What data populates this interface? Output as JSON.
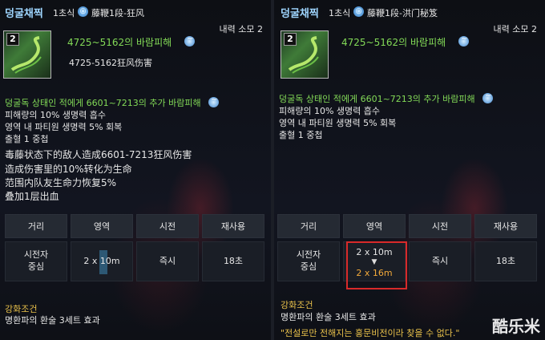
{
  "left": {
    "skill_name": "덩굴채찍",
    "level": "1초식",
    "subtitle_zh": "藤鞭1段-狂风",
    "cost": "내력 소모 2",
    "icon_num": "2",
    "damage": "4725~5162의 바람피해",
    "damage_zh": "4725-5162狂风伤害",
    "extra_damage": "덩굴독 상태인 적에게 6601~7213의 추가 바람피해",
    "lines_ko": [
      "피해량의 10% 생명력 흡수",
      "영역 내 파티원 생명력 5% 회복",
      "출혈 1 중첩"
    ],
    "lines_zh": [
      "毒藤状态下的敌人造成6601-7213狂风伤害",
      "造成伤害里的10%转化为生命",
      "范围内队友生命力恢复5%",
      "叠加1层出血"
    ],
    "table": {
      "headers": [
        "거리",
        "영역",
        "시전",
        "재사용"
      ],
      "distance": [
        "시전자",
        "중심"
      ],
      "area": "2 x 10m",
      "cast": "즉시",
      "cooldown": "18초"
    },
    "cond_label": "강화조건",
    "cond_text": "명환파의 환술 3세트 효과"
  },
  "right": {
    "skill_name": "덩굴채찍",
    "level": "1초식",
    "subtitle_zh": "藤鞭1段-洪门秘笈",
    "cost": "내력 소모 2",
    "icon_num": "2",
    "damage": "4725~5162의 바람피해",
    "extra_damage": "덩굴독 상태인 적에게 6601~7213의 추가 바람피해",
    "lines_ko": [
      "피해량의 10% 생명력 흡수",
      "영역 내 파티원 생명력 5% 회복",
      "출혈 1 중첩"
    ],
    "table": {
      "headers": [
        "거리",
        "영역",
        "시전",
        "재사용"
      ],
      "distance": [
        "시전자",
        "중심"
      ],
      "area_old": "2 x 10m",
      "area_new": "2 x 16m",
      "cast": "즉시",
      "cooldown": "18초"
    },
    "cond_label": "강화조건",
    "cond_text": "명환파의 환술 3세트 효과",
    "legend_quote": "\"전설로만 전해지는 홍문비전이라 찾을 수 없다.\""
  },
  "watermark": "酷乐米",
  "colors": {
    "name": "#9fd6ff",
    "green": "#82d957",
    "gold": "#e8c04a",
    "orange": "#f2a93a",
    "highlight": "#d82a2a"
  }
}
